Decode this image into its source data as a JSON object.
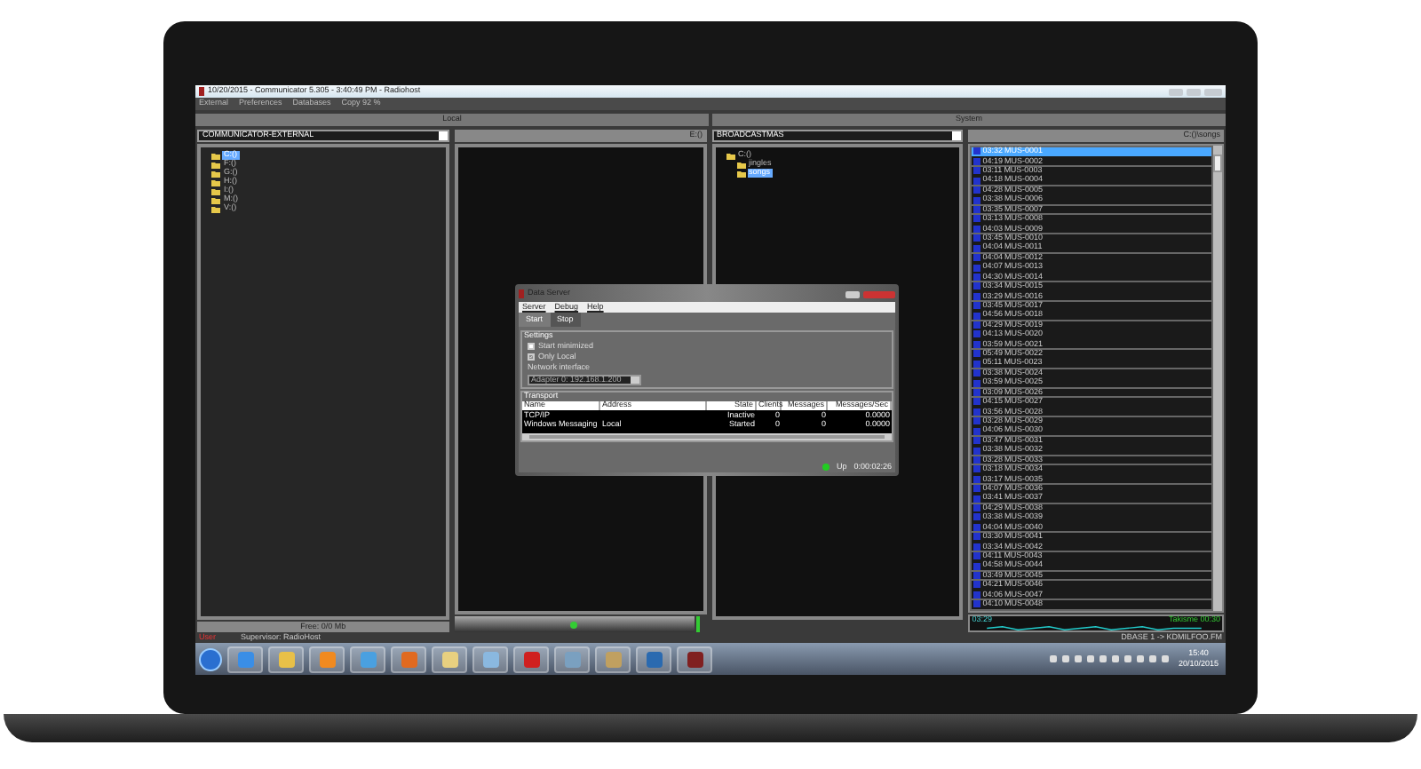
{
  "window": {
    "title": "10/20/2015 - Communicator 5.305 - 3:40:49 PM - Radiohost",
    "menu": [
      "External",
      "Preferences",
      "Databases",
      "Copy 92 %"
    ]
  },
  "sections": [
    "Local",
    "System"
  ],
  "local_tree": {
    "selector": "COMMUNICATOR-EXTERNAL",
    "items": [
      {
        "label": "C:()",
        "selected": true
      },
      {
        "label": "F:()",
        "selected": false
      },
      {
        "label": "G:()",
        "selected": false
      },
      {
        "label": "H:()",
        "selected": false
      },
      {
        "label": "I:()",
        "selected": false
      },
      {
        "label": "M:()",
        "selected": false
      },
      {
        "label": "V:()",
        "selected": false
      }
    ],
    "footer": "Free: 0/0 Mb"
  },
  "local_files": {
    "path": "E:()"
  },
  "system_tree": {
    "selector": "BROADCASTMAS",
    "items": [
      {
        "label": "C:()",
        "selected": false,
        "children": [
          {
            "label": "jingles",
            "selected": false
          },
          {
            "label": "songs",
            "selected": true
          }
        ]
      }
    ]
  },
  "song_list": {
    "path": "C:()\\songs",
    "items": [
      {
        "duration": "03:32",
        "code": "MUS-0001",
        "selected": true
      },
      {
        "duration": "04:19",
        "code": "MUS-0002",
        "selected": false
      },
      {
        "duration": "03:11",
        "code": "MUS-0003",
        "selected": false
      },
      {
        "duration": "04:18",
        "code": "MUS-0004",
        "selected": false
      },
      {
        "duration": "04:28",
        "code": "MUS-0005",
        "selected": false
      },
      {
        "duration": "03:38",
        "code": "MUS-0006",
        "selected": false
      },
      {
        "duration": "03:35",
        "code": "MUS-0007",
        "selected": false
      },
      {
        "duration": "03:13",
        "code": "MUS-0008",
        "selected": false
      },
      {
        "duration": "04:03",
        "code": "MUS-0009",
        "selected": false
      },
      {
        "duration": "03:45",
        "code": "MUS-0010",
        "selected": false
      },
      {
        "duration": "04:04",
        "code": "MUS-0011",
        "selected": false
      },
      {
        "duration": "04:04",
        "code": "MUS-0012",
        "selected": false
      },
      {
        "duration": "04:07",
        "code": "MUS-0013",
        "selected": false
      },
      {
        "duration": "04:30",
        "code": "MUS-0014",
        "selected": false
      },
      {
        "duration": "03:34",
        "code": "MUS-0015",
        "selected": false
      },
      {
        "duration": "03:29",
        "code": "MUS-0016",
        "selected": false
      },
      {
        "duration": "03:45",
        "code": "MUS-0017",
        "selected": false
      },
      {
        "duration": "04:56",
        "code": "MUS-0018",
        "selected": false
      },
      {
        "duration": "04:29",
        "code": "MUS-0019",
        "selected": false
      },
      {
        "duration": "04:13",
        "code": "MUS-0020",
        "selected": false
      },
      {
        "duration": "03:59",
        "code": "MUS-0021",
        "selected": false
      },
      {
        "duration": "05:49",
        "code": "MUS-0022",
        "selected": false
      },
      {
        "duration": "05:11",
        "code": "MUS-0023",
        "selected": false
      },
      {
        "duration": "03:38",
        "code": "MUS-0024",
        "selected": false
      },
      {
        "duration": "03:59",
        "code": "MUS-0025",
        "selected": false
      },
      {
        "duration": "03:09",
        "code": "MUS-0026",
        "selected": false
      },
      {
        "duration": "04:15",
        "code": "MUS-0027",
        "selected": false
      },
      {
        "duration": "03:56",
        "code": "MUS-0028",
        "selected": false
      },
      {
        "duration": "03:28",
        "code": "MUS-0029",
        "selected": false
      },
      {
        "duration": "04:06",
        "code": "MUS-0030",
        "selected": false
      },
      {
        "duration": "03:47",
        "code": "MUS-0031",
        "selected": false
      },
      {
        "duration": "03:38",
        "code": "MUS-0032",
        "selected": false
      },
      {
        "duration": "03:28",
        "code": "MUS-0033",
        "selected": false
      },
      {
        "duration": "03:18",
        "code": "MUS-0034",
        "selected": false
      },
      {
        "duration": "03:17",
        "code": "MUS-0035",
        "selected": false
      },
      {
        "duration": "04:07",
        "code": "MUS-0036",
        "selected": false
      },
      {
        "duration": "03:41",
        "code": "MUS-0037",
        "selected": false
      },
      {
        "duration": "04:29",
        "code": "MUS-0038",
        "selected": false
      },
      {
        "duration": "03:38",
        "code": "MUS-0039",
        "selected": false
      },
      {
        "duration": "04:04",
        "code": "MUS-0040",
        "selected": false
      },
      {
        "duration": "03:30",
        "code": "MUS-0041",
        "selected": false
      },
      {
        "duration": "03:34",
        "code": "MUS-0042",
        "selected": false
      },
      {
        "duration": "04:11",
        "code": "MUS-0043",
        "selected": false
      },
      {
        "duration": "04:58",
        "code": "MUS-0044",
        "selected": false
      },
      {
        "duration": "03:49",
        "code": "MUS-0045",
        "selected": false
      },
      {
        "duration": "04:21",
        "code": "MUS-0046",
        "selected": false
      },
      {
        "duration": "04:06",
        "code": "MUS-0047",
        "selected": false
      },
      {
        "duration": "04:10",
        "code": "MUS-0048",
        "selected": false
      }
    ],
    "meter": {
      "time": "03:29",
      "label": "Takisme 00:30"
    }
  },
  "status_bar": {
    "user": "User",
    "supervisor": "Supervisor: RadioHost",
    "database": "DBASE 1 -> KDMILFOO.FM"
  },
  "taskbar": {
    "time": "15:40",
    "date": "20/10/2015"
  },
  "dialog": {
    "title": "Data Server",
    "menu": [
      "Server",
      "Debug",
      "Help"
    ],
    "buttons": [
      "Start",
      "Stop"
    ],
    "settings": {
      "legend": "Settings",
      "options": [
        {
          "label": "Start minimized",
          "checked": false
        },
        {
          "label": "Only Local",
          "checked": true
        }
      ],
      "interface_label": "Network interface",
      "interface_value": "Adapter 0: 192.168.1.200"
    },
    "transport": {
      "legend": "Transport",
      "columns": [
        "Name",
        "Address",
        "State",
        "Clients",
        "Messages",
        "Messages/Sec"
      ],
      "rows": [
        [
          "TCP/IP",
          "",
          "Inactive",
          "0",
          "0",
          "0.0000"
        ],
        [
          "Windows Messaging",
          "Local",
          "Started",
          "0",
          "0",
          "0.0000"
        ]
      ]
    },
    "status": "Up",
    "uptime": "0:00:02:26"
  }
}
